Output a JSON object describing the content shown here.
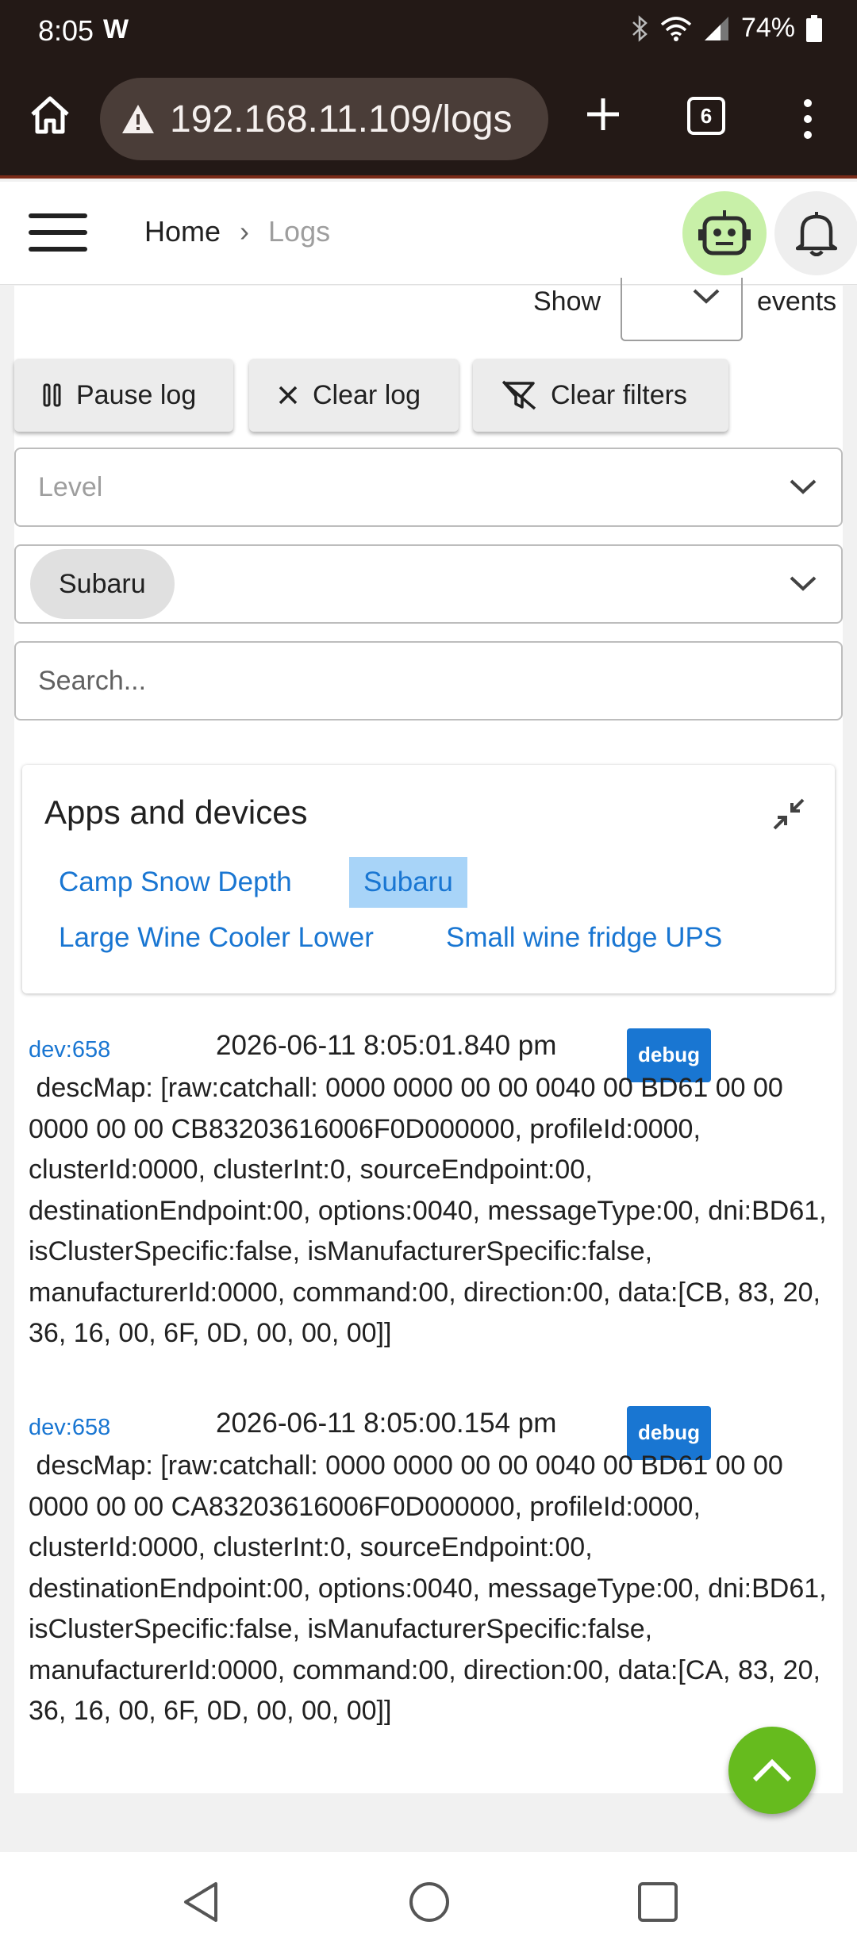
{
  "status_bar": {
    "time": "8:05",
    "carrier_glyph": "W",
    "battery": "74%"
  },
  "browser": {
    "url": "192.168.11.109/logs",
    "tab_count": "6"
  },
  "header": {
    "breadcrumb_home": "Home",
    "breadcrumb_separator": "›",
    "breadcrumb_current": "Logs"
  },
  "controls": {
    "show_label": "Show",
    "show_value": "",
    "events_label": "events",
    "pause_label": "Pause log",
    "clear_label": "Clear log",
    "clear_filters_label": "Clear filters",
    "level_placeholder": "Level",
    "device_chip": "Subaru",
    "search_placeholder": "Search..."
  },
  "apps_card": {
    "title": "Apps and devices",
    "items": [
      {
        "label": "Camp Snow Depth",
        "selected": false
      },
      {
        "label": "Subaru",
        "selected": true
      },
      {
        "label": "Large Wine Cooler Lower",
        "selected": false
      },
      {
        "label": "Small wine fridge UPS",
        "selected": false
      }
    ]
  },
  "logs": [
    {
      "source": "dev:658",
      "timestamp": "2026-06-11 8:05:01.840 pm",
      "level": "debug",
      "message": " descMap: [raw:catchall: 0000 0000 00 00 0040 00 BD61 00 00 0000 00 00 CB83203616006F0D000000, profileId:0000, clusterId:0000, clusterInt:0, sourceEndpoint:00, destinationEndpoint:00, options:0040, messageType:00, dni:BD61, isClusterSpecific:false, isManufacturerSpecific:false, manufacturerId:0000, command:00, direction:00, data:[CB, 83, 20, 36, 16, 00, 6F, 0D, 00, 00, 00]]"
    },
    {
      "source": "dev:658",
      "timestamp": "2026-06-11 8:05:00.154 pm",
      "level": "debug",
      "message": " descMap: [raw:catchall: 0000 0000 00 00 0040 00 BD61 00 00 0000 00 00 CA83203616006F0D000000, profileId:0000, clusterId:0000, clusterInt:0, sourceEndpoint:00, destinationEndpoint:00, options:0040, messageType:00, dni:BD61, isClusterSpecific:false, isManufacturerSpecific:false, manufacturerId:0000, command:00, direction:00, data:[CA, 83, 20, 36, 16, 00, 6F, 0D, 00, 00, 00]]"
    }
  ],
  "colors": {
    "accent": "#1976d2",
    "fab": "#66bb1e",
    "browser_bar": "#231916"
  }
}
